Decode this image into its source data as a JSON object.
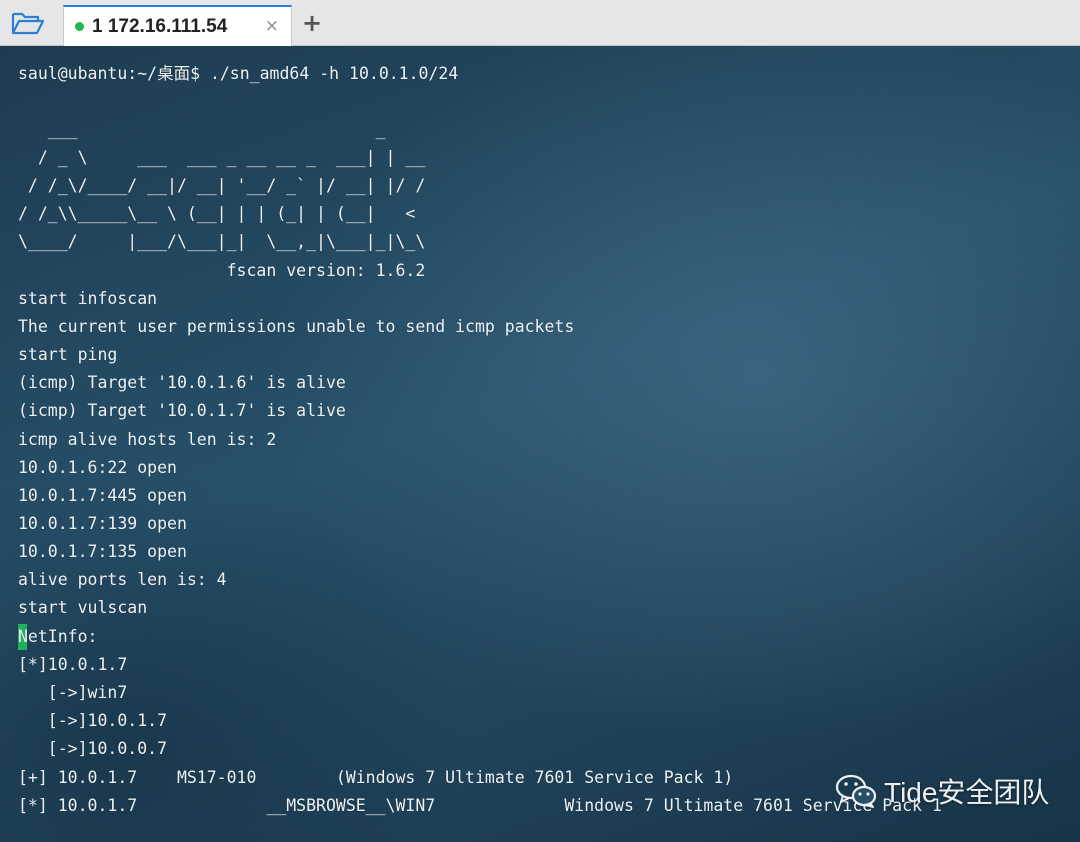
{
  "tabbar": {
    "folder_icon": "folder-open-icon",
    "active_tab": {
      "label": "1 172.16.111.54",
      "status_color": "#1fb84a",
      "close_glyph": "×"
    },
    "add_tab_glyph": "+"
  },
  "terminal": {
    "lines": [
      "saul@ubantu:~/桌面$ ./sn_amd64 -h 10.0.1.0/24",
      "",
      "   ___                              _",
      "  / _ \\     ___  ___ _ __ __ _  ___| | __",
      " / /_\\/____/ __|/ __| '__/ _` |/ __| |/ /",
      "/ /_\\\\_____\\__ \\ (__| | | (_| | (__|   <",
      "\\____/     |___/\\___|_|  \\__,_|\\___|_|\\_\\",
      "                     fscan version: 1.6.2",
      "start infoscan",
      "The current user permissions unable to send icmp packets",
      "start ping",
      "(icmp) Target '10.0.1.6' is alive",
      "(icmp) Target '10.0.1.7' is alive",
      "icmp alive hosts len is: 2",
      "10.0.1.6:22 open",
      "10.0.1.7:445 open",
      "10.0.1.7:139 open",
      "10.0.1.7:135 open",
      "alive ports len is: 4",
      "start vulscan",
      "NetInfo:",
      "[*]10.0.1.7",
      "   [->]win7",
      "   [->]10.0.1.7",
      "   [->]10.0.0.7",
      "[+] 10.0.1.7    MS17-010        (Windows 7 Ultimate 7601 Service Pack 1)",
      "[*] 10.0.1.7             __MSBROWSE__\\WIN7             Windows 7 Ultimate 7601 Service Pack 1"
    ],
    "cursor_color": "#21c45a"
  },
  "watermark": {
    "icon": "wechat-icon",
    "text": "Tide安全团队"
  }
}
